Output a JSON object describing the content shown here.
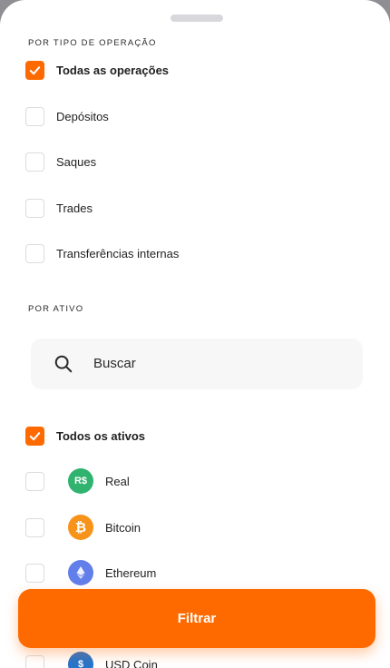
{
  "operations": {
    "title": "POR TIPO DE OPERAÇÃO",
    "items": [
      {
        "label": "Todas as operações",
        "checked": true
      },
      {
        "label": "Depósitos",
        "checked": false
      },
      {
        "label": "Saques",
        "checked": false
      },
      {
        "label": "Trades",
        "checked": false
      },
      {
        "label": "Transferências internas",
        "checked": false
      }
    ]
  },
  "assets": {
    "title": "POR ATIVO",
    "search_placeholder": "Buscar",
    "all_label": "Todos os ativos",
    "items": [
      {
        "label": "Real",
        "icon_text": "R$",
        "icon": "real-icon",
        "color": "#2fb36e",
        "checked": false
      },
      {
        "label": "Bitcoin",
        "icon_text": "₿",
        "icon": "bitcoin-icon",
        "color": "#f7931a",
        "checked": false
      },
      {
        "label": "Ethereum",
        "icon_text": "",
        "icon": "ethereum-icon",
        "color": "#627eea",
        "checked": false
      },
      {
        "label": "USD Coin",
        "icon_text": "$",
        "icon": "usd-coin-icon",
        "color": "#2775ca",
        "checked": false
      }
    ]
  },
  "filter_button_label": "Filtrar",
  "colors": {
    "accent": "#ff6a00"
  }
}
